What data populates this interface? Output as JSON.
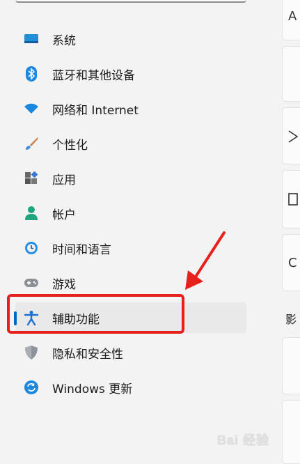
{
  "nav": {
    "items": [
      {
        "label": "系统",
        "icon": "monitor-icon"
      },
      {
        "label": "蓝牙和其他设备",
        "icon": "bluetooth-icon"
      },
      {
        "label": "网络和 Internet",
        "icon": "wifi-icon"
      },
      {
        "label": "个性化",
        "icon": "brush-icon"
      },
      {
        "label": "应用",
        "icon": "apps-icon"
      },
      {
        "label": "帐户",
        "icon": "account-icon"
      },
      {
        "label": "时间和语言",
        "icon": "clock-globe-icon"
      },
      {
        "label": "游戏",
        "icon": "gamepad-icon"
      },
      {
        "label": "辅助功能",
        "icon": "accessibility-icon",
        "selected": true
      },
      {
        "label": "隐私和安全性",
        "icon": "shield-icon"
      },
      {
        "label": "Windows 更新",
        "icon": "update-icon"
      }
    ]
  },
  "right_pane": {
    "section_label": "影",
    "card_glyphs": [
      "A",
      "",
      "",
      "",
      "C",
      "",
      "",
      ""
    ]
  },
  "watermark": "Bai 经验",
  "colors": {
    "accent": "#0067c0",
    "highlight": "#e8201b"
  }
}
